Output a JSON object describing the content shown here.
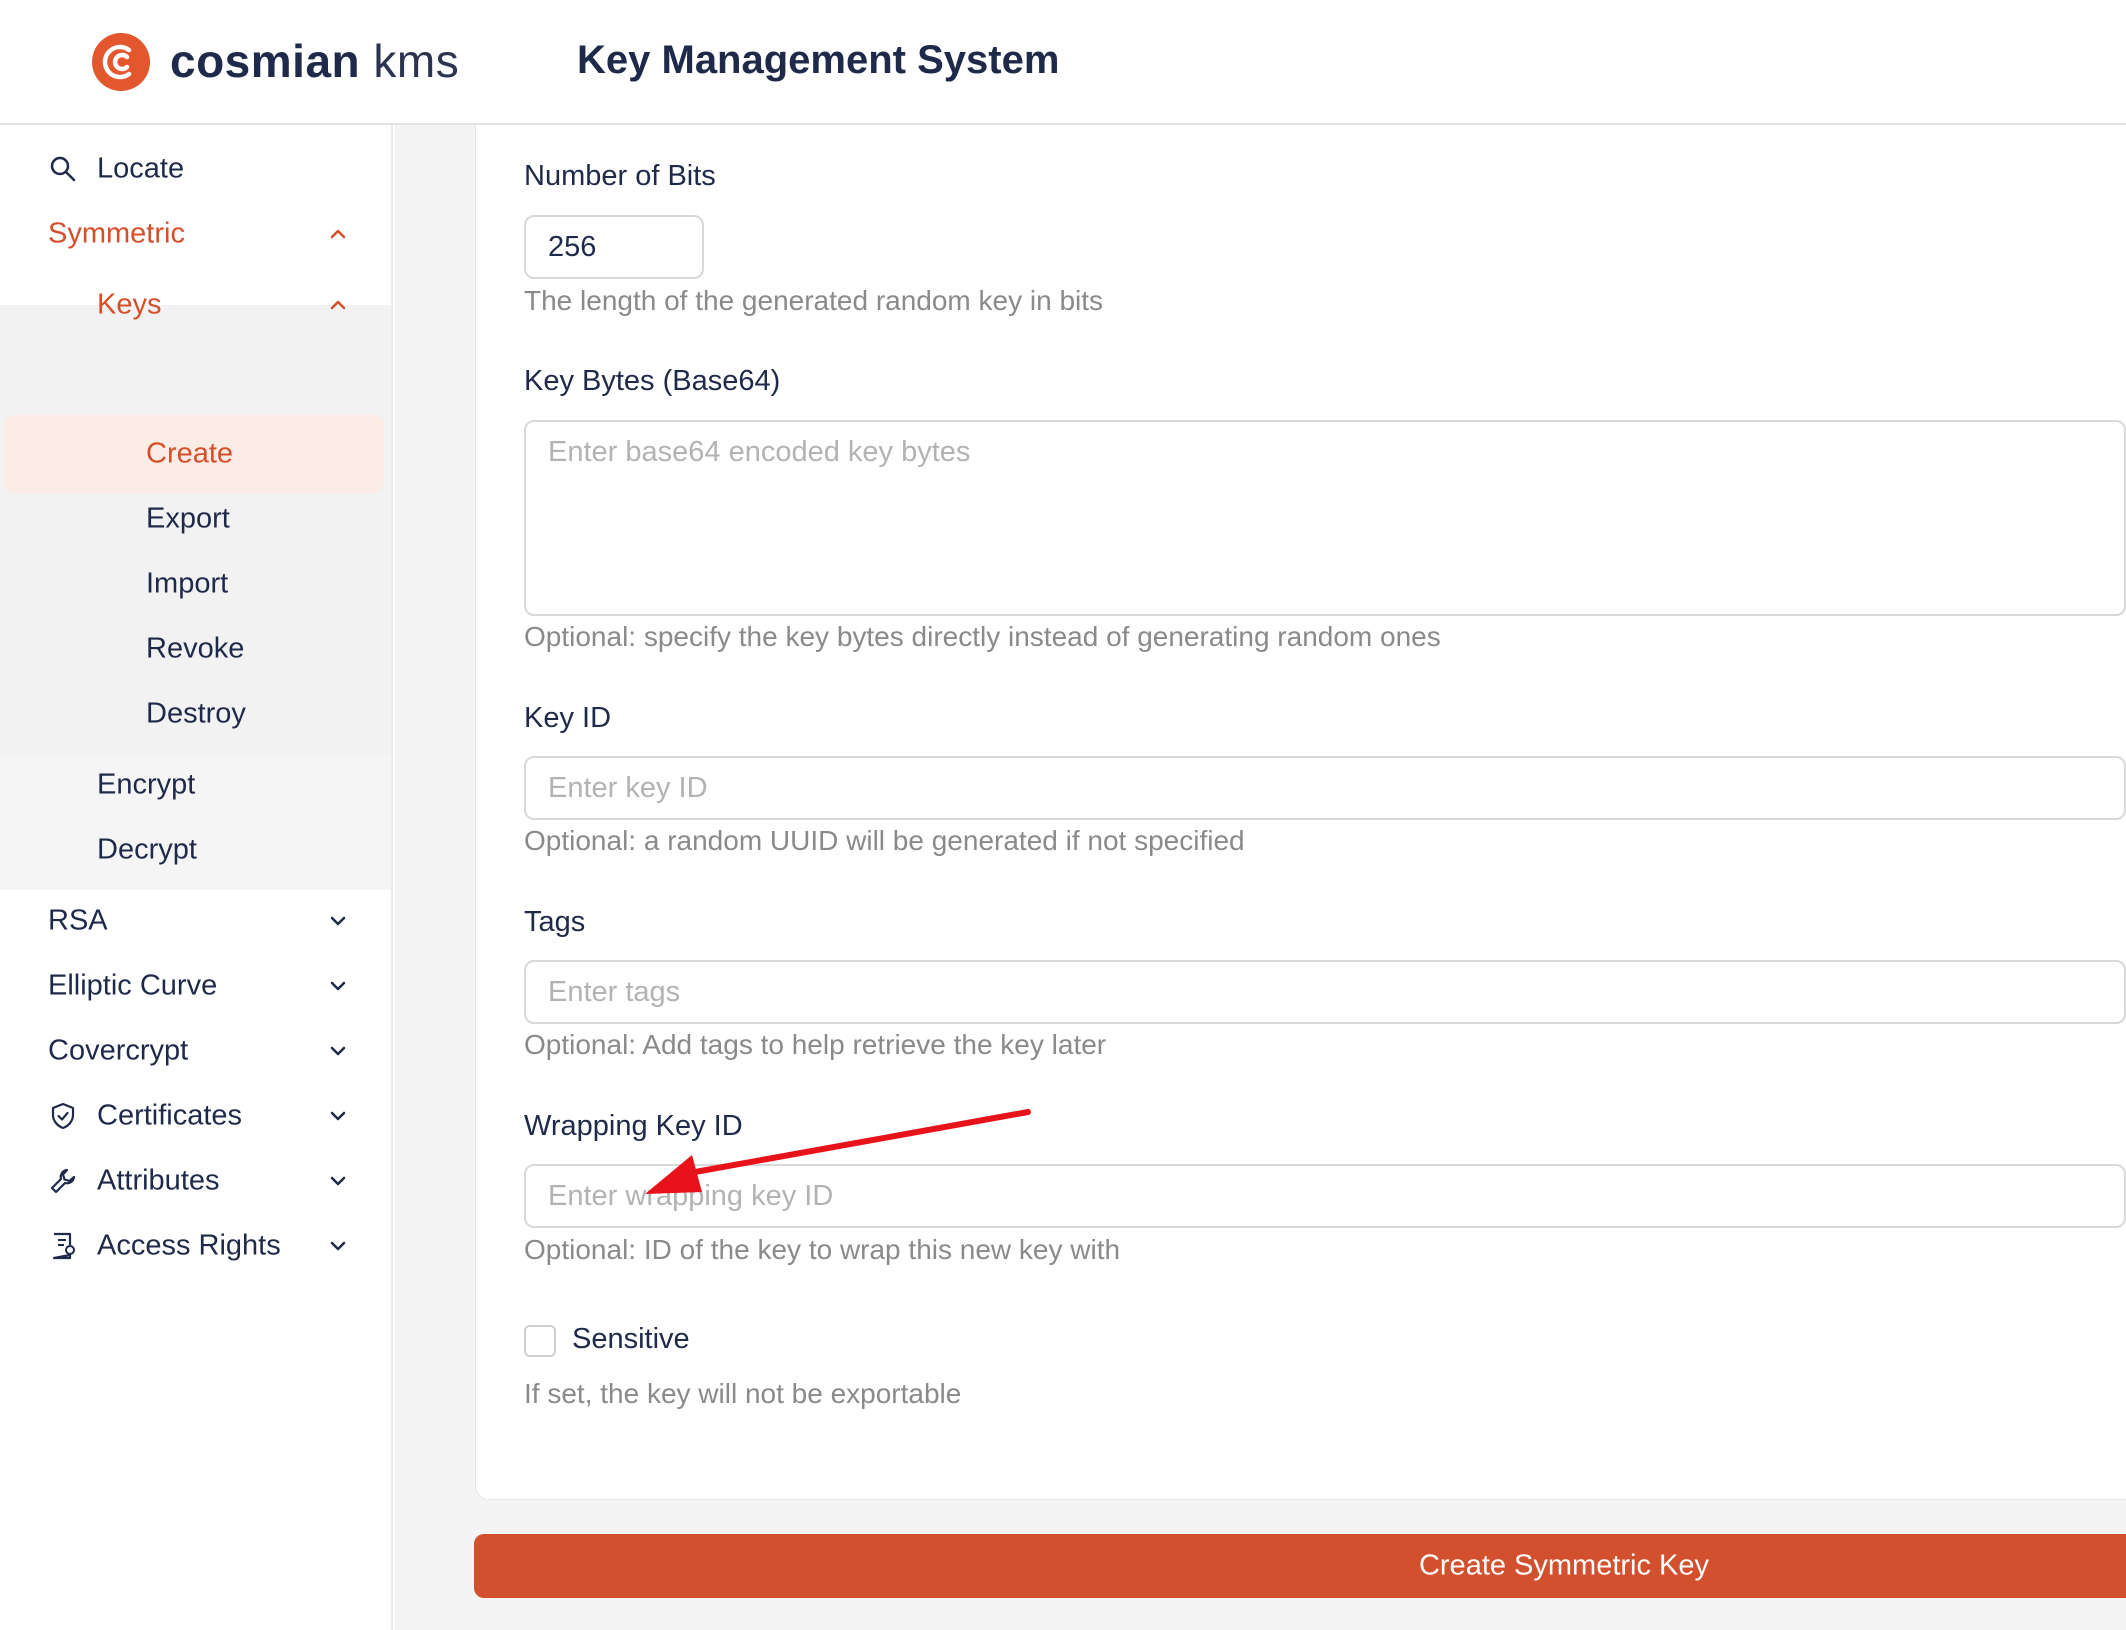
{
  "header": {
    "logo_brand": "cosmian",
    "logo_product": "kms",
    "app_title": "Key Management System"
  },
  "sidebar": {
    "locate": "Locate",
    "symmetric": "Symmetric",
    "keys": "Keys",
    "keys_items": [
      "Create",
      "Export",
      "Import",
      "Revoke",
      "Destroy"
    ],
    "encrypt": "Encrypt",
    "decrypt": "Decrypt",
    "rsa": "RSA",
    "elliptic_curve": "Elliptic Curve",
    "covercrypt": "Covercrypt",
    "certificates": "Certificates",
    "attributes": "Attributes",
    "access_rights": "Access Rights",
    "active_color": "#d44f2a"
  },
  "form": {
    "bits": {
      "label": "Number of Bits",
      "value": "256",
      "help": "The length of the generated random key in bits"
    },
    "key_bytes": {
      "label": "Key Bytes (Base64)",
      "placeholder": "Enter base64 encoded key bytes",
      "help": "Optional: specify the key bytes directly instead of generating random ones"
    },
    "key_id": {
      "label": "Key ID",
      "placeholder": "Enter key ID",
      "help": "Optional: a random UUID will be generated if not specified"
    },
    "tags": {
      "label": "Tags",
      "placeholder": "Enter tags",
      "help": "Optional: Add tags to help retrieve the key later"
    },
    "wrapping_key_id": {
      "label": "Wrapping Key ID",
      "placeholder": "Enter wrapping key ID",
      "help": "Optional: ID of the key to wrap this new key with"
    },
    "sensitive": {
      "label": "Sensitive",
      "checked": false,
      "help": "If set, the key will not be exportable"
    },
    "submit_label": "Create Symmetric Key"
  },
  "annotation": {
    "arrow_color": "#e8121b"
  }
}
